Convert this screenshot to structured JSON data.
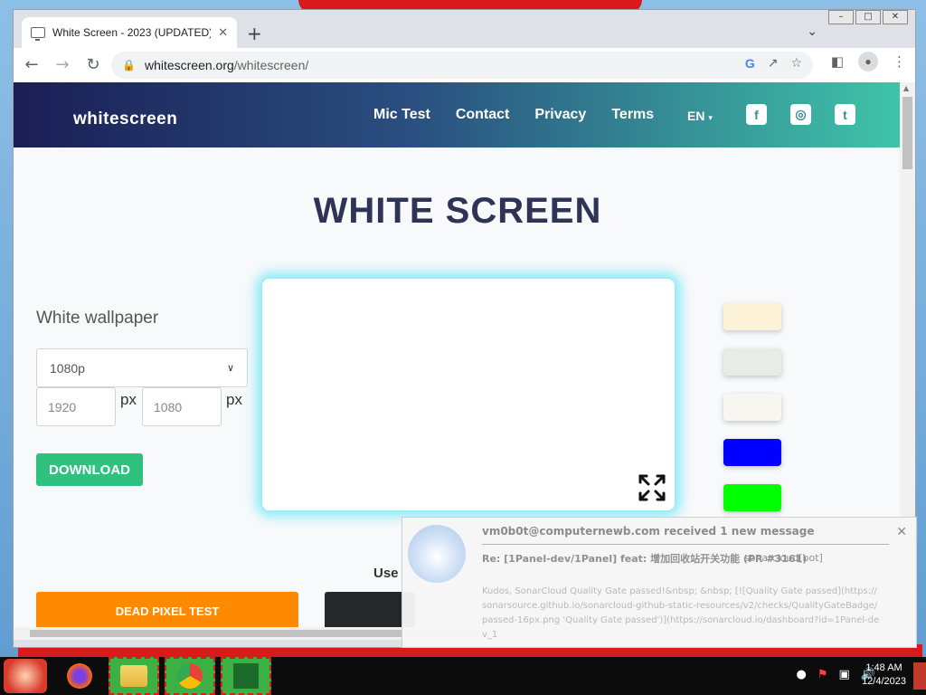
{
  "window": {
    "controls": [
      "–",
      "□",
      "✕"
    ]
  },
  "tab": {
    "title": "White Screen - 2023 (UPDATED)",
    "close": "✕",
    "new_tab": "+",
    "dropdown": "⌄"
  },
  "toolbar": {
    "back": "←",
    "forward": "→",
    "reload": "↻",
    "url_host": "whitescreen.org",
    "url_path": "/whitescreen/"
  },
  "site": {
    "logo": "whitescreen",
    "nav": [
      "Mic Test",
      "Contact",
      "Privacy",
      "Terms"
    ],
    "lang": "EN",
    "socials": [
      "f",
      "◎",
      "t"
    ],
    "title": "WHITE SCREEN"
  },
  "controls": {
    "label": "White wallpaper",
    "resolution": "1080p",
    "width_placeholder": "1920",
    "height_placeholder": "1080",
    "px": "px",
    "download": "DOWNLOAD"
  },
  "swatches": [
    "#fcf3d9",
    "#e9ece5",
    "#f7f6f0",
    "#0000ff",
    "#00ff00"
  ],
  "bottom": {
    "use_text": "Use",
    "dead_pixel": "DEAD PIXEL TEST"
  },
  "notification": {
    "title": "vm0b0t@computernewb.com received 1 new message",
    "subject": "Re: [1Panel-dev/1Panel] feat: 增加回收站开关功能 (PR #3161)",
    "sender": "sonarcloud[bot]",
    "body": "Kudos, SonarCloud Quality Gate passed!&nbsp; &nbsp; [![Quality Gate passed](https://sonarsource.github.io/sonarcloud-github-static-resources/v2/checks/QualityGateBadge/passed-16px.png 'Quality Gate passed')](https://sonarcloud.io/dashboard?id=1Panel-dev_1",
    "close": "✕"
  },
  "taskbar": {
    "time": "1:48 AM",
    "date": "12/4/2023"
  }
}
